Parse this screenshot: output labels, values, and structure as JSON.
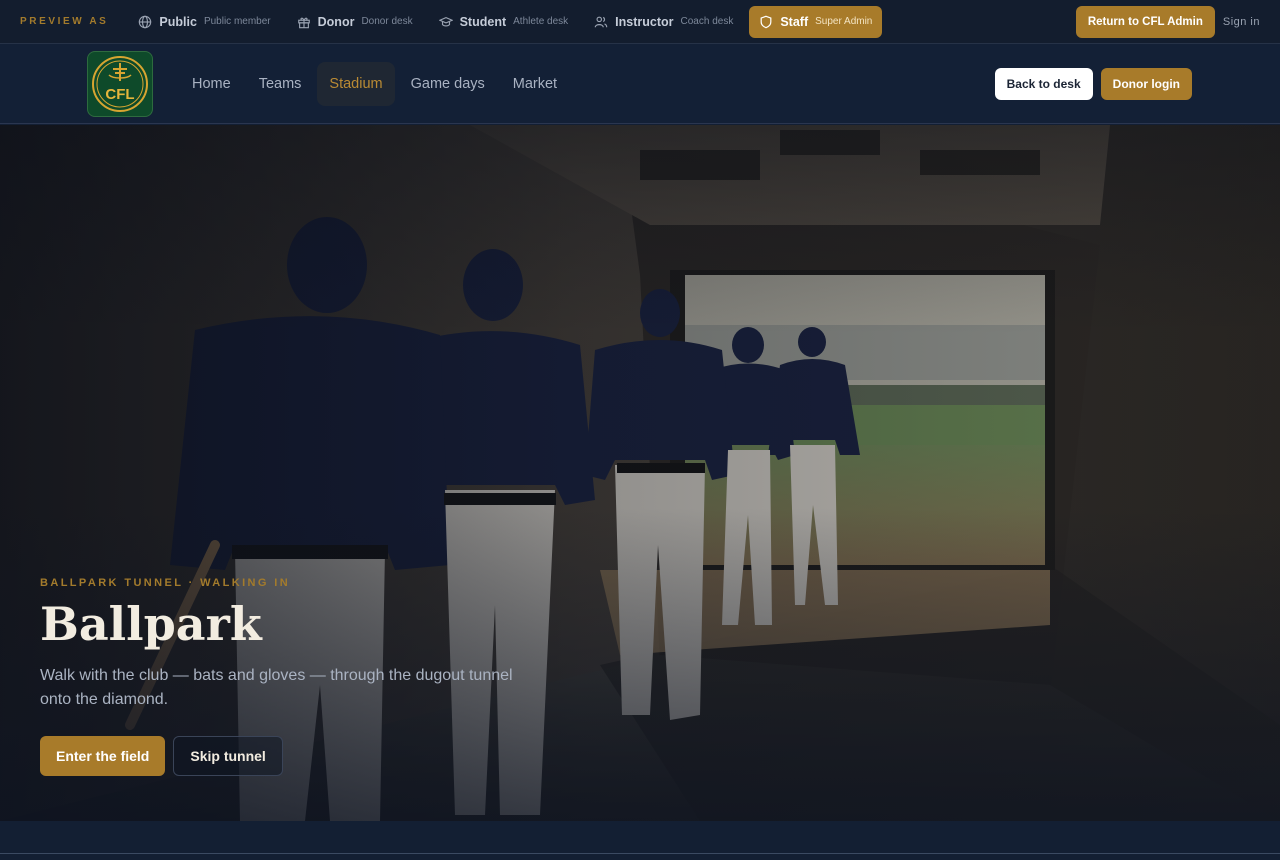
{
  "preview": {
    "label": "PREVIEW AS",
    "roles": [
      {
        "name": "Public",
        "sub": "Public member",
        "icon": "globe-icon"
      },
      {
        "name": "Donor",
        "sub": "Donor desk",
        "icon": "gift-icon"
      },
      {
        "name": "Student",
        "sub": "Athlete desk",
        "icon": "graduation-cap-icon"
      },
      {
        "name": "Instructor",
        "sub": "Coach desk",
        "icon": "users-icon"
      },
      {
        "name": "Staff",
        "sub": "Super Admin",
        "icon": "shield-icon",
        "active": true
      }
    ],
    "return_label": "Return to CFL Admin",
    "signin_label": "Sign in"
  },
  "nav": {
    "logo_text": "CFL",
    "links": [
      "Home",
      "Teams",
      "Stadium",
      "Game days",
      "Market"
    ],
    "active_link": "Stadium",
    "back_label": "Back to desk",
    "donor_label": "Donor login"
  },
  "hero": {
    "eyebrow": "BALLPARK TUNNEL · WALKING IN",
    "title": "Ballpark",
    "description": "Walk with the club — bats and gloves — through the dugout tunnel onto the diamond.",
    "primary_label": "Enter the field",
    "secondary_label": "Skip tunnel"
  },
  "colors": {
    "accent": "#a87b2a",
    "navy": "#131f33",
    "logo_green": "#0e4a2a"
  }
}
